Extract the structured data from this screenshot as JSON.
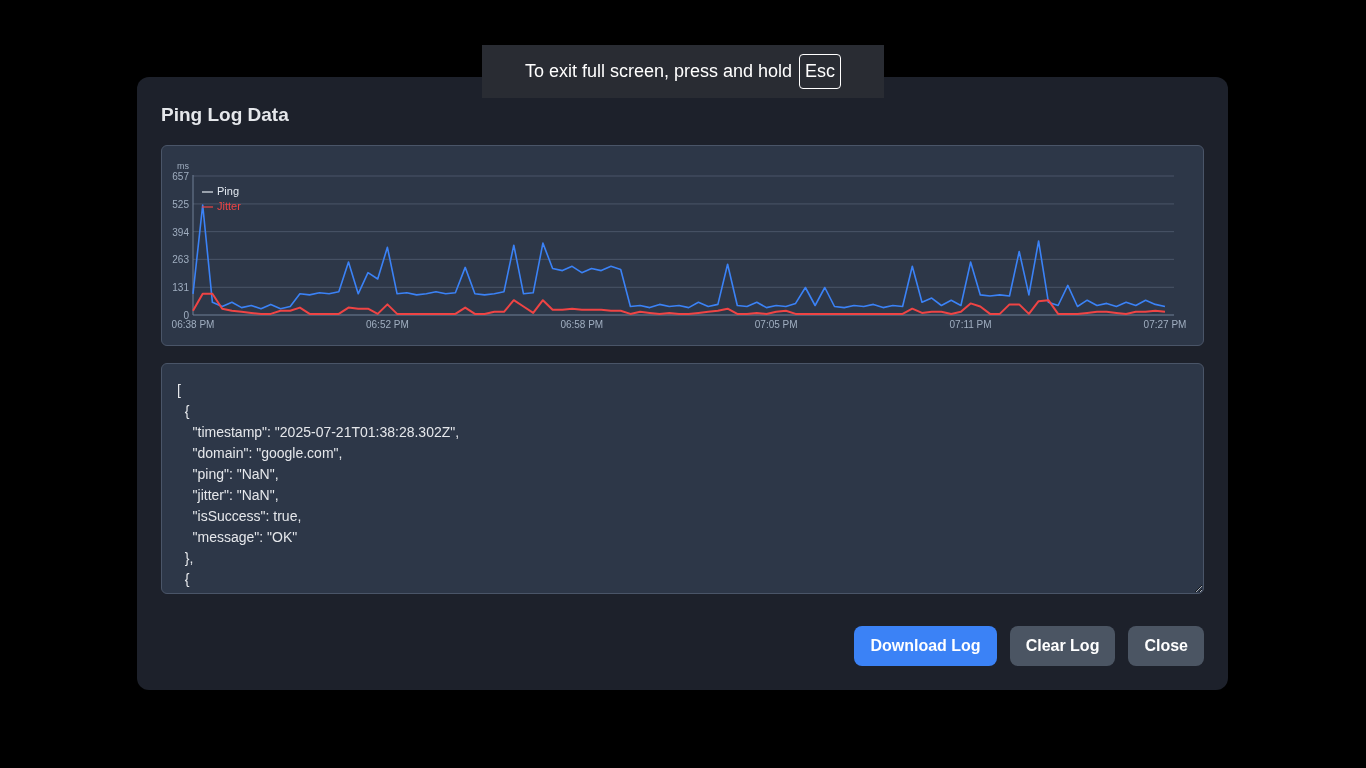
{
  "fullscreen_notice": {
    "text": "To exit full screen, press and hold",
    "key": "Esc"
  },
  "dialog": {
    "title": "Ping Log Data",
    "chart": {
      "chart_data": {
        "type": "line",
        "ylabel": "ms",
        "categories": [
          "06:38 PM",
          null,
          null,
          null,
          null,
          null,
          null,
          null,
          null,
          null,
          null,
          null,
          null,
          null,
          null,
          null,
          null,
          null,
          null,
          null,
          "06:52 PM",
          null,
          null,
          null,
          null,
          null,
          null,
          null,
          null,
          null,
          null,
          null,
          null,
          null,
          null,
          null,
          null,
          null,
          null,
          null,
          "06:58 PM",
          null,
          null,
          null,
          null,
          null,
          null,
          null,
          null,
          null,
          null,
          null,
          null,
          null,
          null,
          null,
          null,
          null,
          null,
          null,
          "07:05 PM",
          null,
          null,
          null,
          null,
          null,
          null,
          null,
          null,
          null,
          null,
          null,
          null,
          null,
          null,
          null,
          null,
          null,
          null,
          null,
          "07:11 PM",
          null,
          null,
          null,
          null,
          null,
          null,
          null,
          null,
          null,
          null,
          null,
          null,
          null,
          null,
          null,
          null,
          null,
          null,
          null,
          "07:27 PM"
        ],
        "series": [
          {
            "name": "Ping",
            "color": "#3b82f6",
            "values": [
              100,
              520,
              60,
              40,
              60,
              35,
              45,
              30,
              50,
              30,
              40,
              100,
              95,
              105,
              100,
              110,
              250,
              100,
              200,
              170,
              320,
              100,
              105,
              95,
              100,
              110,
              100,
              105,
              225,
              100,
              95,
              100,
              110,
              330,
              100,
              105,
              340,
              220,
              210,
              230,
              200,
              220,
              210,
              230,
              215,
              40,
              45,
              35,
              50,
              40,
              45,
              35,
              60,
              40,
              50,
              240,
              45,
              40,
              60,
              35,
              45,
              40,
              55,
              130,
              45,
              130,
              40,
              35,
              45,
              40,
              50,
              35,
              45,
              40,
              230,
              60,
              80,
              45,
              70,
              45,
              250,
              95,
              90,
              95,
              90,
              300,
              95,
              350,
              60,
              45,
              140,
              40,
              70,
              45,
              55,
              40,
              60,
              45,
              70,
              50,
              40
            ]
          },
          {
            "name": "Jitter",
            "color": "#ef4444",
            "values": [
              20,
              100,
              100,
              30,
              20,
              15,
              10,
              5,
              5,
              20,
              20,
              35,
              5,
              5,
              5,
              5,
              35,
              30,
              30,
              5,
              50,
              5,
              5,
              5,
              5,
              5,
              5,
              5,
              35,
              5,
              5,
              15,
              15,
              70,
              40,
              10,
              70,
              25,
              25,
              30,
              25,
              25,
              25,
              20,
              20,
              5,
              15,
              10,
              5,
              10,
              5,
              5,
              10,
              15,
              20,
              30,
              5,
              5,
              10,
              5,
              15,
              20,
              5,
              5,
              5,
              5,
              5,
              5,
              5,
              5,
              5,
              5,
              5,
              5,
              30,
              10,
              15,
              15,
              5,
              15,
              55,
              40,
              5,
              5,
              50,
              50,
              5,
              65,
              70,
              5,
              5,
              5,
              10,
              15,
              15,
              10,
              5,
              15,
              15,
              20,
              15
            ]
          }
        ],
        "ylim": [
          0,
          657
        ],
        "grid": true,
        "yticks": [
          0,
          131,
          263,
          394,
          525,
          657
        ]
      }
    },
    "log_text": {
      "lines": [
        "[",
        "  {",
        "    \"timestamp\": \"2025-07-21T01:38:28.302Z\",",
        "    \"domain\": \"google.com\",",
        "    \"ping\": \"NaN\",",
        "    \"jitter\": \"NaN\",",
        "    \"isSuccess\": true,",
        "    \"message\": \"OK\"",
        "  },",
        "  {"
      ]
    },
    "buttons": [
      {
        "label": "Download Log",
        "kind": "primary"
      },
      {
        "label": "Clear Log",
        "kind": "secondary"
      },
      {
        "label": "Close",
        "kind": "secondary"
      }
    ]
  }
}
